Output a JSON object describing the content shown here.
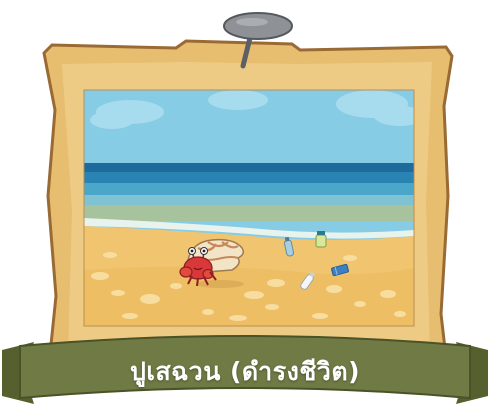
{
  "card": {
    "caption": "ปูเสฉวน (ดำรงชีวิต)",
    "subject": "hermit-crab",
    "setting": "beach-with-litter"
  },
  "colors": {
    "frame": "#E7BE6F",
    "frame_inner": "#F6D99C",
    "frame_outline": "#9A6A34",
    "sky": "#86CCE4",
    "sea_deep": "#1F6A9C",
    "sand": "#F1C56F",
    "ribbon": "#6F7A45",
    "pin": "#8E9297"
  },
  "icons": {
    "pin": "push-pin-icon",
    "crab": "hermit-crab-icon",
    "litter": [
      "plastic-bottle-icon",
      "glass-jar-icon",
      "plastic-bottle-icon",
      "plastic-wrapper-icon"
    ]
  }
}
